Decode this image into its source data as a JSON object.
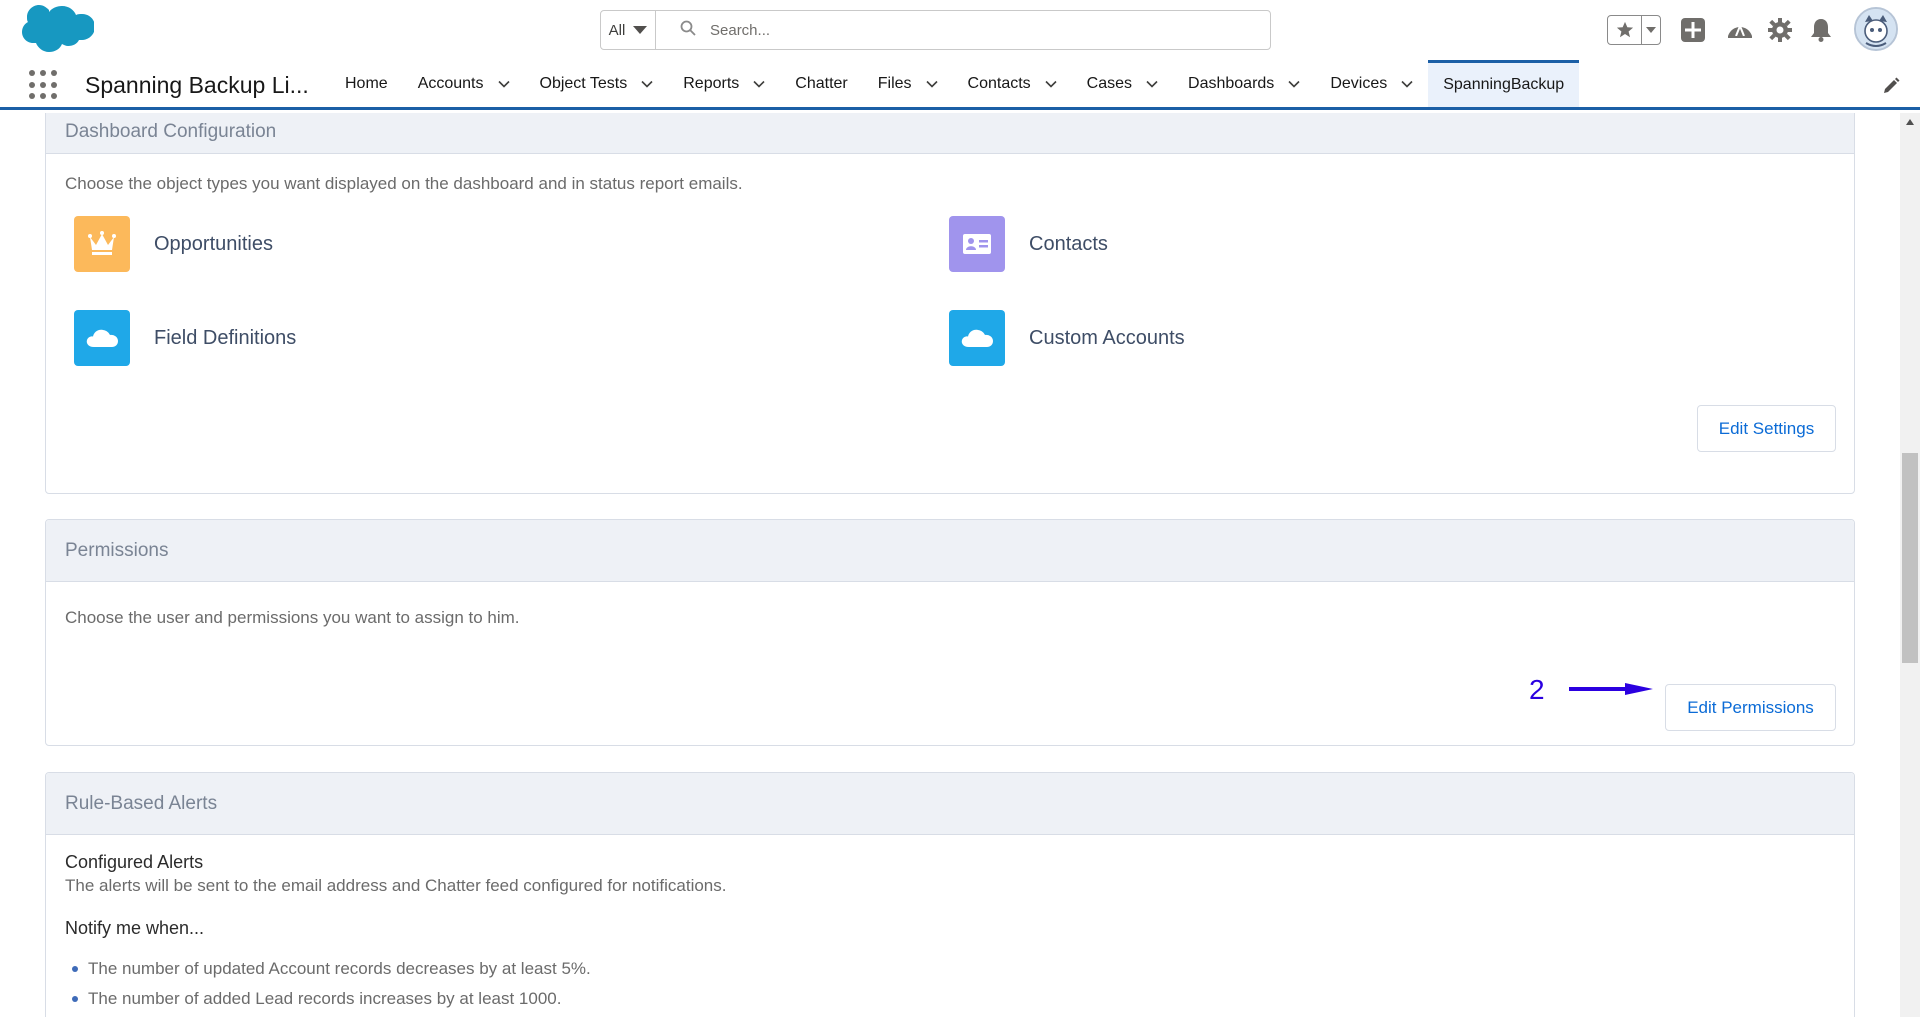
{
  "header": {
    "search_scope": "All",
    "search_placeholder": "Search...",
    "colors": {
      "cloud": "#1798c1",
      "icon_gray": "#706e6b"
    }
  },
  "nav": {
    "app_name": "Spanning Backup Li...",
    "items": [
      {
        "label": "Home",
        "has_menu": false
      },
      {
        "label": "Accounts",
        "has_menu": true
      },
      {
        "label": "Object Tests",
        "has_menu": true
      },
      {
        "label": "Reports",
        "has_menu": true
      },
      {
        "label": "Chatter",
        "has_menu": false
      },
      {
        "label": "Files",
        "has_menu": true
      },
      {
        "label": "Contacts",
        "has_menu": true
      },
      {
        "label": "Cases",
        "has_menu": true
      },
      {
        "label": "Dashboards",
        "has_menu": true
      },
      {
        "label": "Devices",
        "has_menu": true
      },
      {
        "label": "SpanningBackup",
        "has_menu": false,
        "active": true
      }
    ]
  },
  "dashboard_config": {
    "title": "Dashboard Configuration",
    "description": "Choose the object types you want displayed on the dashboard and in status report emails.",
    "objects": [
      {
        "label": "Opportunities",
        "icon": "crown-icon",
        "color": "#fcb95b"
      },
      {
        "label": "Contacts",
        "icon": "contact-card-icon",
        "color": "#a094ed"
      },
      {
        "label": "Field Definitions",
        "icon": "cloud-icon",
        "color": "#1fa8e8"
      },
      {
        "label": "Custom Accounts",
        "icon": "cloud-icon",
        "color": "#1fa8e8"
      }
    ],
    "button": "Edit Settings"
  },
  "permissions": {
    "title": "Permissions",
    "description": "Choose the user and permissions you want to assign to him.",
    "annotation_number": "2",
    "annotation_color": "#2b00e0",
    "button": "Edit Permissions"
  },
  "rule_alerts": {
    "title": "Rule-Based Alerts",
    "configured_title": "Configured Alerts",
    "configured_text": "The alerts will be sent to the email address and Chatter feed configured for notifications.",
    "notify_title": "Notify me when...",
    "rules": [
      "The number of updated Account records decreases by at least 5%.",
      "The number of added Lead records increases by at least 1000."
    ]
  }
}
